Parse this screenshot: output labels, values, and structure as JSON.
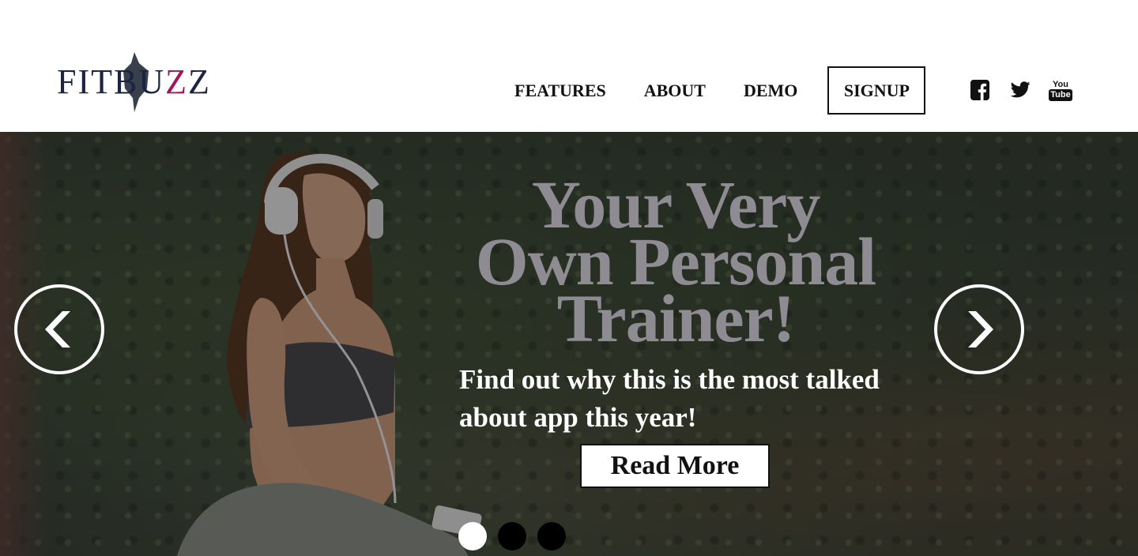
{
  "header": {
    "logo": {
      "text_main": "FITBU",
      "text_accent": "Z",
      "text_tail": "Z",
      "alt": "FITBUZZ"
    },
    "nav": [
      {
        "label": "FEATURES"
      },
      {
        "label": "ABOUT"
      },
      {
        "label": "DEMO"
      },
      {
        "label": "SIGNUP"
      }
    ],
    "social": [
      {
        "icon": "facebook-icon"
      },
      {
        "icon": "twitter-icon"
      },
      {
        "icon": "youtube-icon",
        "top": "You",
        "bottom": "Tube"
      }
    ]
  },
  "hero": {
    "headline_line1": "Your Very",
    "headline_line2": "Own Personal",
    "headline_line3": "Trainer!",
    "subtext": "Find out why this is the most talked about app this year!",
    "cta_label": "Read More",
    "prev_glyph": "❮",
    "next_glyph": "❯",
    "slides": 3,
    "active_slide": 1
  },
  "colors": {
    "brand_navy": "#1b2440",
    "brand_accent": "#a4165a",
    "headline": "#8f8b93"
  }
}
